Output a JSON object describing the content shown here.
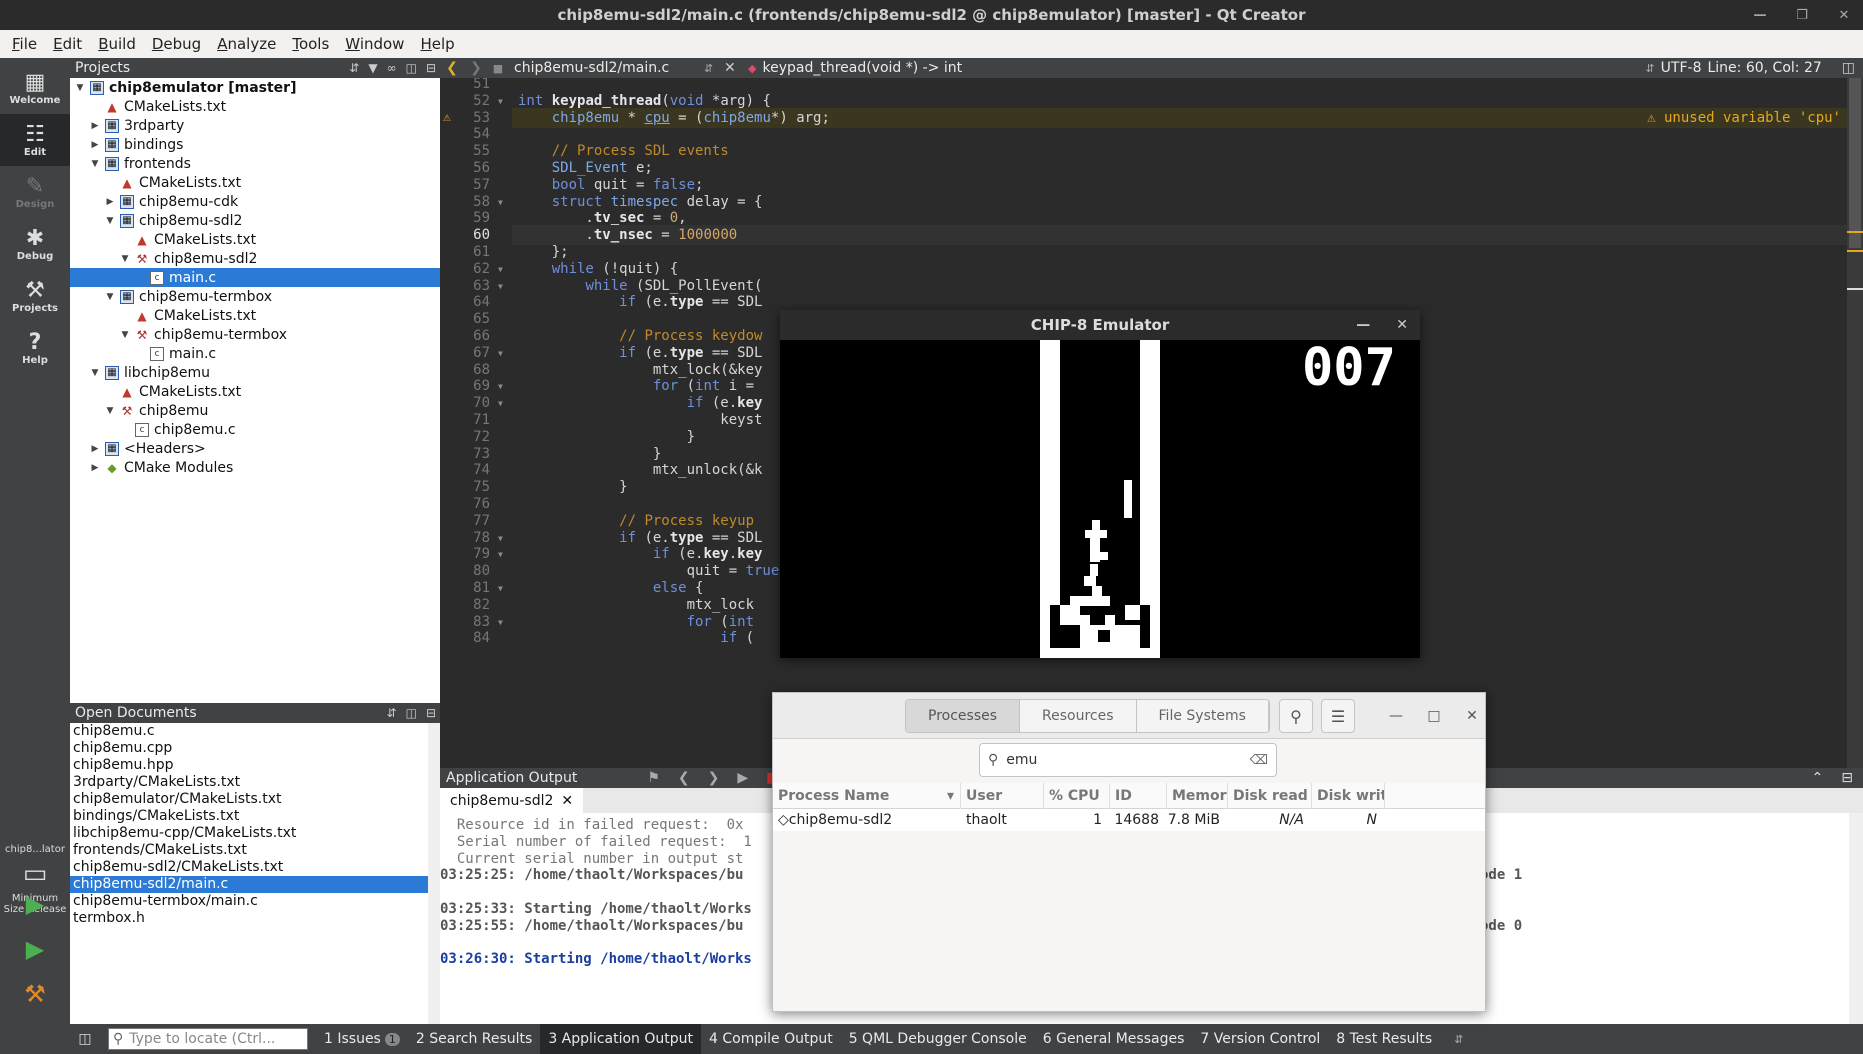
{
  "window": {
    "title": "chip8emu-sdl2/main.c (frontends/chip8emu-sdl2 @ chip8emulator) [master] - Qt Creator"
  },
  "menu": [
    "File",
    "Edit",
    "Build",
    "Debug",
    "Analyze",
    "Tools",
    "Window",
    "Help"
  ],
  "modes": [
    {
      "label": "Welcome",
      "icon": "grid-icon",
      "glyph": "▦"
    },
    {
      "label": "Edit",
      "icon": "document-icon",
      "glyph": "☷"
    },
    {
      "label": "Design",
      "icon": "pen-icon",
      "glyph": "✎"
    },
    {
      "label": "Debug",
      "icon": "bug-icon",
      "glyph": "✱"
    },
    {
      "label": "Projects",
      "icon": "wrench-icon",
      "glyph": "⚒"
    },
    {
      "label": "Help",
      "icon": "help-icon",
      "glyph": "?"
    }
  ],
  "kit": {
    "name": "chip8...lator",
    "build": "Minimum Size Release"
  },
  "projects": {
    "title": "Projects",
    "tree": [
      {
        "label": "chip8emulator [master]",
        "depth": 0,
        "arrow": "down",
        "icon": "proj",
        "bold": true
      },
      {
        "label": "CMakeLists.txt",
        "depth": 1,
        "arrow": "",
        "icon": "cmake"
      },
      {
        "label": "3rdparty",
        "depth": 1,
        "arrow": "right",
        "icon": "proj"
      },
      {
        "label": "bindings",
        "depth": 1,
        "arrow": "right",
        "icon": "proj"
      },
      {
        "label": "frontends",
        "depth": 1,
        "arrow": "down",
        "icon": "proj"
      },
      {
        "label": "CMakeLists.txt",
        "depth": 2,
        "arrow": "",
        "icon": "cmake"
      },
      {
        "label": "chip8emu-cdk",
        "depth": 2,
        "arrow": "right",
        "icon": "proj"
      },
      {
        "label": "chip8emu-sdl2",
        "depth": 2,
        "arrow": "down",
        "icon": "proj"
      },
      {
        "label": "CMakeLists.txt",
        "depth": 3,
        "arrow": "",
        "icon": "cmake"
      },
      {
        "label": "chip8emu-sdl2",
        "depth": 3,
        "arrow": "down",
        "icon": "hammer"
      },
      {
        "label": "main.c",
        "depth": 4,
        "arrow": "",
        "icon": "c",
        "selected": true
      },
      {
        "label": "chip8emu-termbox",
        "depth": 2,
        "arrow": "down",
        "icon": "proj"
      },
      {
        "label": "CMakeLists.txt",
        "depth": 3,
        "arrow": "",
        "icon": "cmake"
      },
      {
        "label": "chip8emu-termbox",
        "depth": 3,
        "arrow": "down",
        "icon": "hammer"
      },
      {
        "label": "main.c",
        "depth": 4,
        "arrow": "",
        "icon": "c"
      },
      {
        "label": "libchip8emu",
        "depth": 1,
        "arrow": "down",
        "icon": "proj"
      },
      {
        "label": "CMakeLists.txt",
        "depth": 2,
        "arrow": "",
        "icon": "cmake"
      },
      {
        "label": "chip8emu",
        "depth": 2,
        "arrow": "down",
        "icon": "hammer"
      },
      {
        "label": "chip8emu.c",
        "depth": 3,
        "arrow": "",
        "icon": "c"
      },
      {
        "label": "<Headers>",
        "depth": 1,
        "arrow": "right",
        "icon": "proj"
      },
      {
        "label": "CMake Modules",
        "depth": 1,
        "arrow": "right",
        "icon": "cm"
      }
    ]
  },
  "open_documents": {
    "title": "Open Documents",
    "items": [
      "chip8emu.c",
      "chip8emu.cpp",
      "chip8emu.hpp",
      "3rdparty/CMakeLists.txt",
      "chip8emulator/CMakeLists.txt",
      "bindings/CMakeLists.txt",
      "libchip8emu-cpp/CMakeLists.txt",
      "frontends/CMakeLists.txt",
      "chip8emu-sdl2/CMakeLists.txt",
      "chip8emu-sdl2/main.c",
      "chip8emu-termbox/main.c",
      "termbox.h"
    ],
    "selected_index": 9
  },
  "editor": {
    "file": "chip8emu-sdl2/main.c",
    "symbol": "keypad_thread(void *) -> int",
    "encoding": "UTF-8",
    "position": "Line: 60, Col: 27",
    "warning": "unused variable 'cpu'",
    "current_line": 60,
    "warning_line": 53,
    "lines": [
      {
        "n": 51,
        "html": ""
      },
      {
        "n": 52,
        "html": "<span class='kw'>int</span> <span class='fn'>keypad_thread</span>(<span class='kw'>void</span> *arg) {"
      },
      {
        "n": 53,
        "html": "    <span class='ty'>chip8emu</span> * <span class='und'>cpu</span> = (<span class='ty'>chip8emu</span>*) arg;"
      },
      {
        "n": 54,
        "html": ""
      },
      {
        "n": 55,
        "html": "    <span class='cm'>// Process SDL events</span>"
      },
      {
        "n": 56,
        "html": "    <span class='ty'>SDL_Event</span> e;"
      },
      {
        "n": 57,
        "html": "    <span class='kw'>bool</span> quit = <span class='kw'>false</span>;"
      },
      {
        "n": 58,
        "html": "    <span class='kw'>struct</span> <span class='ty'>timespec</span> delay = {"
      },
      {
        "n": 59,
        "html": "        .<span class='mem'>tv_sec</span> = <span class='num'>0</span>,"
      },
      {
        "n": 60,
        "html": "        .<span class='mem'>tv_nsec</span> = <span class='num'>1000000</span>"
      },
      {
        "n": 61,
        "html": "    };"
      },
      {
        "n": 62,
        "html": "    <span class='kw'>while</span> (!quit) {"
      },
      {
        "n": 63,
        "html": "        <span class='kw'>while</span> (SDL_PollEvent("
      },
      {
        "n": 64,
        "html": "            <span class='kw'>if</span> (e.<span class='mem'>type</span> == SDL"
      },
      {
        "n": 65,
        "html": ""
      },
      {
        "n": 66,
        "html": "            <span class='cm'>// Process keydow</span>"
      },
      {
        "n": 67,
        "html": "            <span class='kw'>if</span> (e.<span class='mem'>type</span> == SDL"
      },
      {
        "n": 68,
        "html": "                mtx_lock(&key"
      },
      {
        "n": 69,
        "html": "                <span class='kw'>for</span> (<span class='kw'>int</span> i ="
      },
      {
        "n": 70,
        "html": "                    <span class='kw'>if</span> (e.<span class='mem'>key</span>"
      },
      {
        "n": 71,
        "html": "                        keyst"
      },
      {
        "n": 72,
        "html": "                    }"
      },
      {
        "n": 73,
        "html": "                }"
      },
      {
        "n": 74,
        "html": "                mtx_unlock(&k"
      },
      {
        "n": 75,
        "html": "            }"
      },
      {
        "n": 76,
        "html": ""
      },
      {
        "n": 77,
        "html": "            <span class='cm'>// Process keyup</span>"
      },
      {
        "n": 78,
        "html": "            <span class='kw'>if</span> (e.<span class='mem'>type</span> == SDL"
      },
      {
        "n": 79,
        "html": "                <span class='kw'>if</span> (e.<span class='mem'>key</span>.<span class='mem'>key</span>"
      },
      {
        "n": 80,
        "html": "                    quit = <span class='kw'>true</span>;"
      },
      {
        "n": 81,
        "html": "                <span class='kw'>else</span> {"
      },
      {
        "n": 82,
        "html": "                    mtx_lock"
      },
      {
        "n": 83,
        "html": "                    <span class='kw'>for</span> (<span class='kw'>int</span>"
      },
      {
        "n": 84,
        "html": "                        <span class='kw'>if</span> ("
      }
    ],
    "fold_lines": [
      52,
      58,
      62,
      63,
      67,
      69,
      70,
      78,
      79,
      81,
      83
    ]
  },
  "output": {
    "title": "Application Output",
    "tab": "chip8emu-sdl2",
    "lines": [
      {
        "text": "  Resource id in failed request:  0x",
        "style": "gray"
      },
      {
        "text": "  Serial number of failed request:  1",
        "style": "gray"
      },
      {
        "text": "  Current serial number in output st",
        "style": "gray"
      },
      {
        "text": "03:25:25: /home/thaolt/Workspaces/bu",
        "style": "bold",
        "tail": "ode 1"
      },
      {
        "text": "",
        "style": "gray"
      },
      {
        "text": "03:25:33: Starting /home/thaolt/Works",
        "style": "bold"
      },
      {
        "text": "03:25:55: /home/thaolt/Workspaces/bu",
        "style": "bold",
        "tail": "ode 0"
      },
      {
        "text": "",
        "style": "gray"
      },
      {
        "text": "03:26:30: Starting /home/thaolt/Works",
        "style": "blue"
      }
    ]
  },
  "statusbar": {
    "locator_placeholder": "Type to locate (Ctrl...",
    "tabs": [
      {
        "label": "1 Issues",
        "badge": "1"
      },
      {
        "label": "2 Search Results"
      },
      {
        "label": "3 Application Output",
        "active": true
      },
      {
        "label": "4 Compile Output"
      },
      {
        "label": "5 QML Debugger Console"
      },
      {
        "label": "6 General Messages"
      },
      {
        "label": "7 Version Control"
      },
      {
        "label": "8 Test Results"
      }
    ]
  },
  "emulator": {
    "title": "CHIP-8 Emulator",
    "score": "007"
  },
  "system_monitor": {
    "tabs": [
      "Processes",
      "Resources",
      "File Systems"
    ],
    "active_tab": "Processes",
    "search_value": "emu",
    "columns": [
      "Process Name",
      "User",
      "% CPU",
      "ID",
      "Memory",
      "Disk read tot",
      "Disk write"
    ],
    "rows": [
      {
        "name": "chip8emu-sdl2",
        "user": "thaolt",
        "cpu": "1",
        "id": "14688",
        "memory": "7.8 MiB",
        "disk_read": "N/A",
        "disk_write": "N"
      }
    ]
  }
}
